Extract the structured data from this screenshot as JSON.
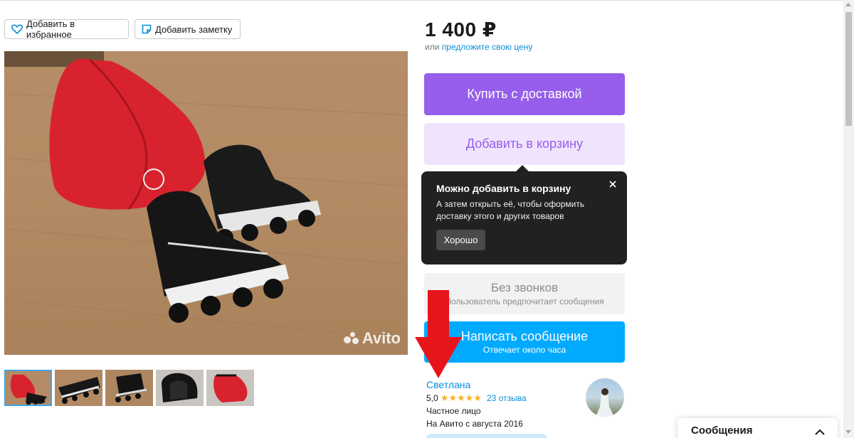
{
  "toolbar": {
    "favorite_label": "Добавить в избранное",
    "favorite_icon": "heart-outline-icon",
    "note_label": "Добавить заметку",
    "note_icon": "note-icon"
  },
  "listing": {
    "price": "1 400 ₽",
    "price_or": "или",
    "price_offer_link": "предложите свою цену",
    "photo_watermark": "Avito",
    "thumbnail_count": 5,
    "active_thumbnail": 1
  },
  "actions": {
    "buy_label": "Купить с доставкой",
    "cart_label": "Добавить в корзину",
    "no_calls_title": "Без звонков",
    "no_calls_subtitle": "Пользователь предпочитает сообщения",
    "message_title": "Написать сообщение",
    "message_subtitle": "Отвечает около часа"
  },
  "tooltip": {
    "title": "Можно добавить в корзину",
    "text": "А затем открыть её, чтобы оформить доставку этого и других товаров",
    "ok_label": "Хорошо",
    "close_icon": "close-icon"
  },
  "seller": {
    "name": "Светлана",
    "rating": "5,0",
    "stars": "★★★★★",
    "reviews": "23 отзыва",
    "type": "Частное лицо",
    "since": "На Авито с августа 2016"
  },
  "messages_panel": {
    "label": "Сообщения",
    "chevron_icon": "chevron-up-icon"
  },
  "colors": {
    "buy": "#965eeb",
    "cart_bg": "#f0e4fd",
    "message": "#00aaff",
    "link": "#0a8ed9",
    "tooltip_bg": "#212121",
    "annotation_arrow": "#e8141b"
  }
}
